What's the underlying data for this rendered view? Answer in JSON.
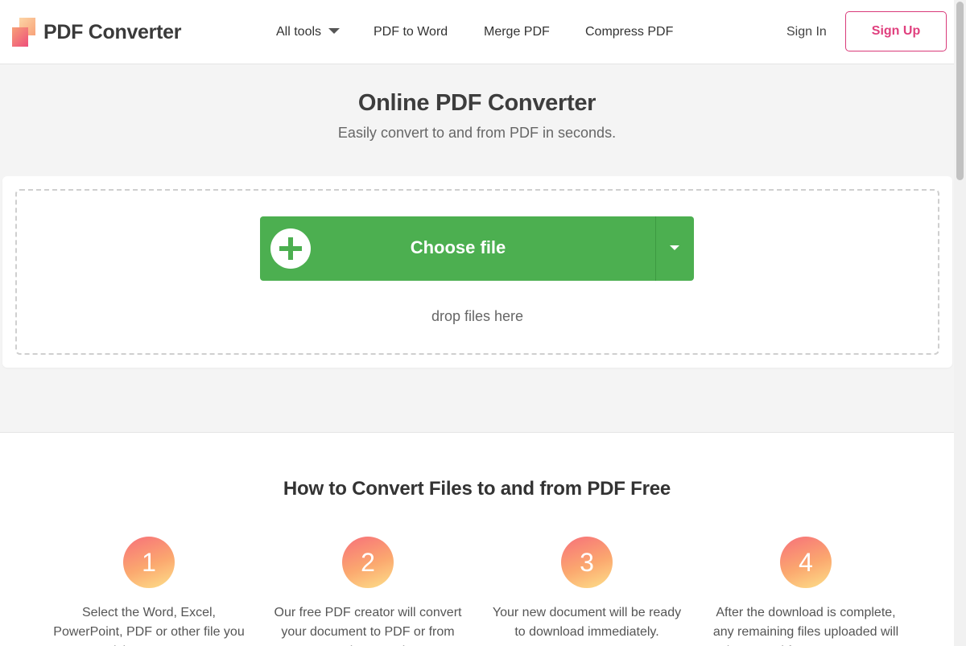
{
  "header": {
    "logo_text": "PDF Converter",
    "nav": [
      {
        "label": "All tools",
        "has_caret": true
      },
      {
        "label": "PDF to Word"
      },
      {
        "label": "Merge PDF"
      },
      {
        "label": "Compress PDF"
      }
    ],
    "sign_in": "Sign In",
    "sign_up": "Sign Up"
  },
  "hero": {
    "title": "Online PDF Converter",
    "subtitle": "Easily convert to and from PDF in seconds."
  },
  "upload": {
    "choose_label": "Choose file",
    "drop_text": "drop files here",
    "icons": {
      "add": "plus-circle-icon",
      "more": "chevron-down-icon"
    }
  },
  "howto": {
    "title": "How to Convert Files to and from PDF Free",
    "steps": [
      {
        "num": "1",
        "text": "Select the Word, Excel, PowerPoint, PDF or other file you wish to convert."
      },
      {
        "num": "2",
        "text": "Our free PDF creator will convert your document to PDF or from PDF in seconds."
      },
      {
        "num": "3",
        "text": "Your new document will be ready to download immediately."
      },
      {
        "num": "4",
        "text": "After the download is complete, any remaining files uploaded will be erased from our servers."
      }
    ]
  },
  "colors": {
    "accent_green": "#4caf50",
    "signup_pink": "#e0407e",
    "page_bg": "#f4f4f4"
  }
}
